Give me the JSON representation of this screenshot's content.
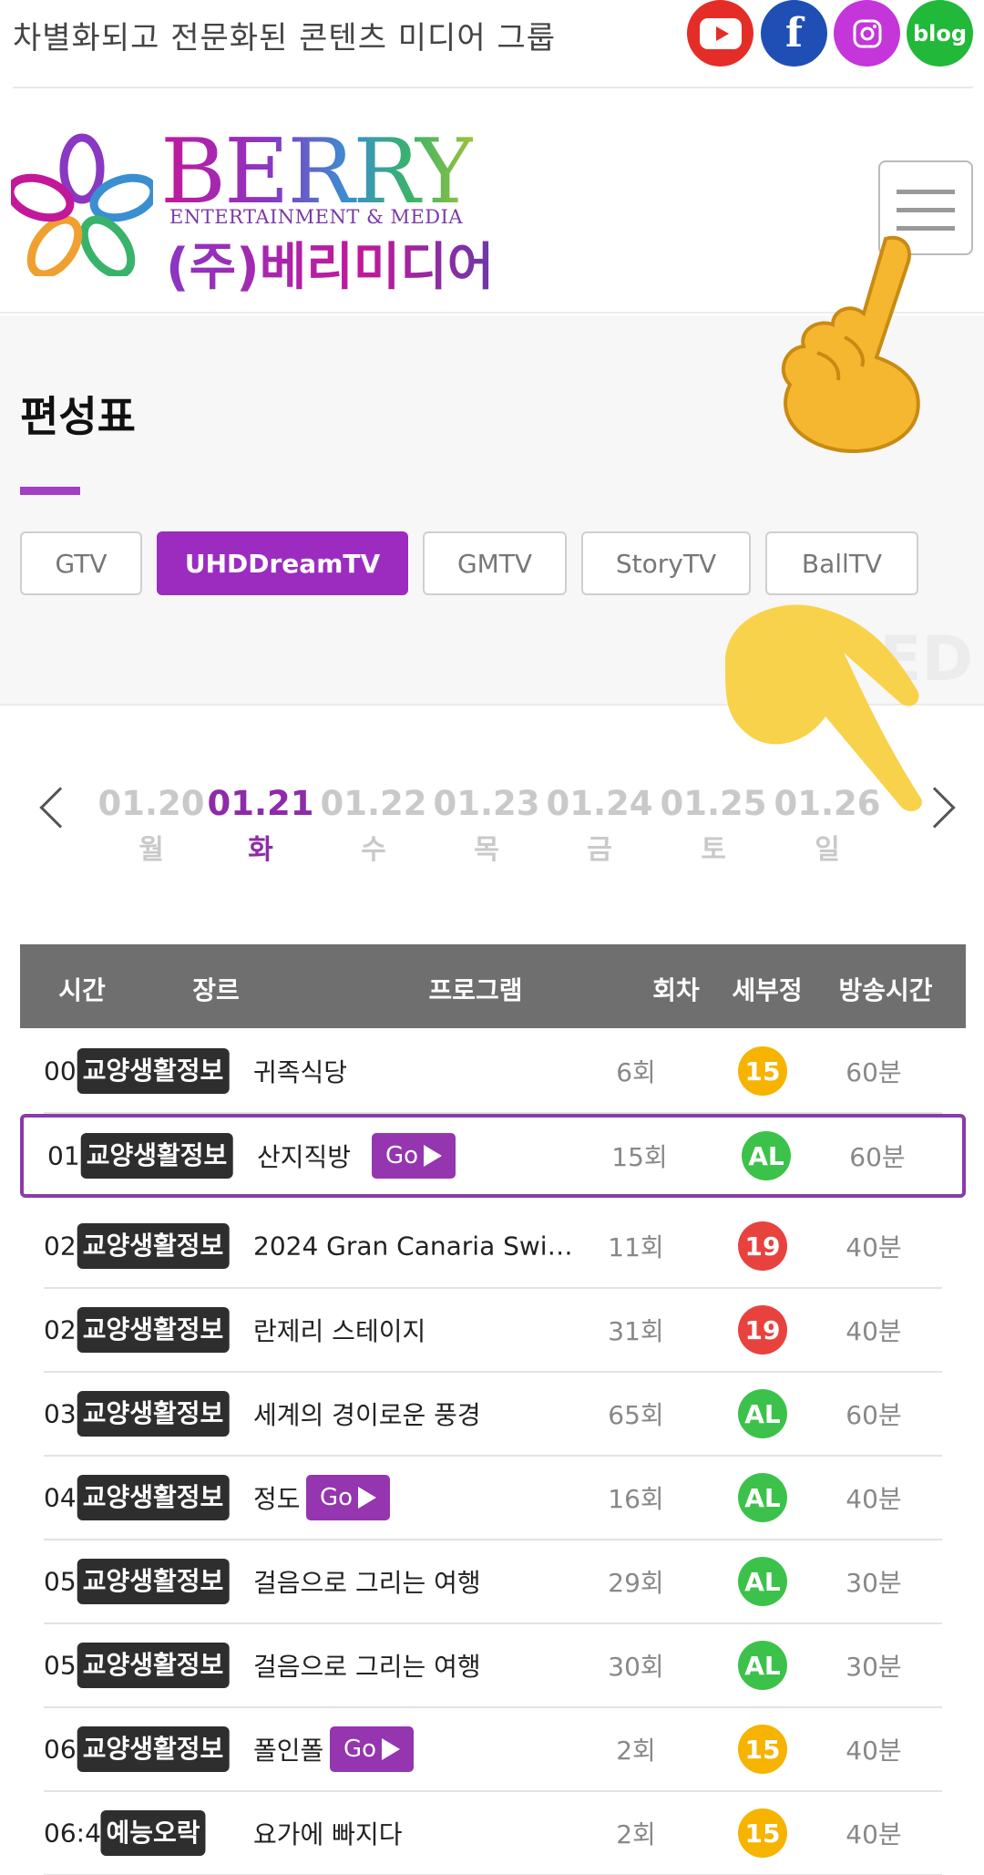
{
  "topbar": {
    "tagline": "차별화되고 전문화된 콘텐츠 미디어 그룹",
    "social": [
      {
        "name": "youtube",
        "icon": "youtube-icon",
        "color": "#e52d27"
      },
      {
        "name": "facebook",
        "icon": "facebook-icon",
        "label": "f",
        "color": "#1f4fb5"
      },
      {
        "name": "instagram",
        "icon": "instagram-icon",
        "color": "#c436d9"
      },
      {
        "name": "blog",
        "icon": "blog-icon",
        "label": "blog",
        "color": "#22b83a"
      }
    ]
  },
  "logo": {
    "main": "BERRY",
    "sub": "ENTERTAINMENT & MEDIA",
    "korean": "(주)베리미디어"
  },
  "schedule": {
    "title": "편성표",
    "watermark": "ED",
    "channels": [
      {
        "label": "GTV",
        "active": false
      },
      {
        "label": "UHDDreamTV",
        "active": true
      },
      {
        "label": "GMTV",
        "active": false
      },
      {
        "label": "StoryTV",
        "active": false
      },
      {
        "label": "BallTV",
        "active": false
      }
    ],
    "dates": [
      {
        "date": "01.20",
        "weekday": "월",
        "active": false
      },
      {
        "date": "01.21",
        "weekday": "화",
        "active": true
      },
      {
        "date": "01.22",
        "weekday": "수",
        "active": false
      },
      {
        "date": "01.23",
        "weekday": "목",
        "active": false
      },
      {
        "date": "01.24",
        "weekday": "금",
        "active": false
      },
      {
        "date": "01.25",
        "weekday": "토",
        "active": false
      },
      {
        "date": "01.26",
        "weekday": "일",
        "active": false
      }
    ]
  },
  "table": {
    "headers": {
      "time": "시간",
      "genre": "장르",
      "program": "프로그램",
      "episode": "회차",
      "rating": "세부정",
      "duration": "방송시간"
    },
    "go_label": "Go",
    "rows": [
      {
        "time": "00:00",
        "genre": "교양생활정보",
        "program": "귀족식당",
        "go": false,
        "episode": "6회",
        "rating": "15",
        "duration": "60분",
        "highlight": false
      },
      {
        "time": "01:00",
        "genre": "교양생활정보",
        "program": "산지직방",
        "go": true,
        "episode": "15회",
        "rating": "AL",
        "duration": "60분",
        "highlight": true
      },
      {
        "time": "02:00",
        "genre": "교양생활정보",
        "program": "2024 Gran Canaria Swi…",
        "go": false,
        "episode": "11회",
        "rating": "19",
        "duration": "40분",
        "highlight": false
      },
      {
        "time": "02:40",
        "genre": "교양생활정보",
        "program": "란제리 스테이지",
        "go": false,
        "episode": "31회",
        "rating": "19",
        "duration": "40분",
        "highlight": false
      },
      {
        "time": "03:20",
        "genre": "교양생활정보",
        "program": "세계의 경이로운 풍경",
        "go": false,
        "episode": "65회",
        "rating": "AL",
        "duration": "60분",
        "highlight": false
      },
      {
        "time": "04:20",
        "genre": "교양생활정보",
        "program": "정도",
        "go": true,
        "episode": "16회",
        "rating": "AL",
        "duration": "40분",
        "highlight": false
      },
      {
        "time": "05:00",
        "genre": "교양생활정보",
        "program": "걸음으로 그리는 여행",
        "go": false,
        "episode": "29회",
        "rating": "AL",
        "duration": "30분",
        "highlight": false
      },
      {
        "time": "05:30",
        "genre": "교양생활정보",
        "program": "걸음으로 그리는 여행",
        "go": false,
        "episode": "30회",
        "rating": "AL",
        "duration": "30분",
        "highlight": false
      },
      {
        "time": "06:00",
        "genre": "교양생활정보",
        "program": "폴인폴",
        "go": true,
        "episode": "2회",
        "rating": "15",
        "duration": "40분",
        "highlight": false
      },
      {
        "time": "06:40",
        "genre": "예능오락",
        "program": "요가에 빠지다",
        "go": false,
        "episode": "2회",
        "rating": "15",
        "duration": "40분",
        "highlight": false
      }
    ]
  },
  "colors": {
    "accent": "#9c2cbf",
    "header_bg": "#6f6f6f",
    "rating_15": "#f6b300",
    "rating_19": "#e8423f",
    "rating_AL": "#3cc24a"
  }
}
